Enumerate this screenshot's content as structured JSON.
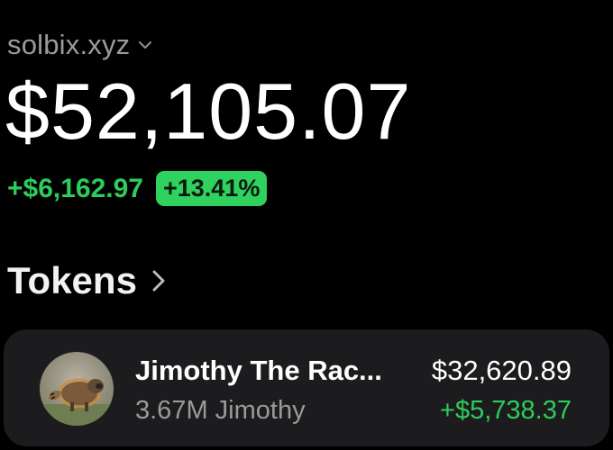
{
  "account": {
    "name": "solbix.xyz",
    "dropdown_icon": "chevron-down-icon"
  },
  "portfolio": {
    "balance": "$52,105.07",
    "change_amount": "+$6,162.97",
    "change_percent": "+13.41%"
  },
  "tokens_section": {
    "title": "Tokens",
    "nav_icon": "chevron-right-icon"
  },
  "tokens": [
    {
      "name": "Jimothy The Rac...",
      "amount": "3.67M Jimothy",
      "value": "$32,620.89",
      "change": "+$5,738.37",
      "avatar_icon": "raccoon-avatar-icon"
    }
  ],
  "colors": {
    "background": "#000000",
    "positive": "#2ecc5a",
    "badge": "#2fd15f",
    "card": "#1c1c1e",
    "muted": "#9b9b9b"
  }
}
